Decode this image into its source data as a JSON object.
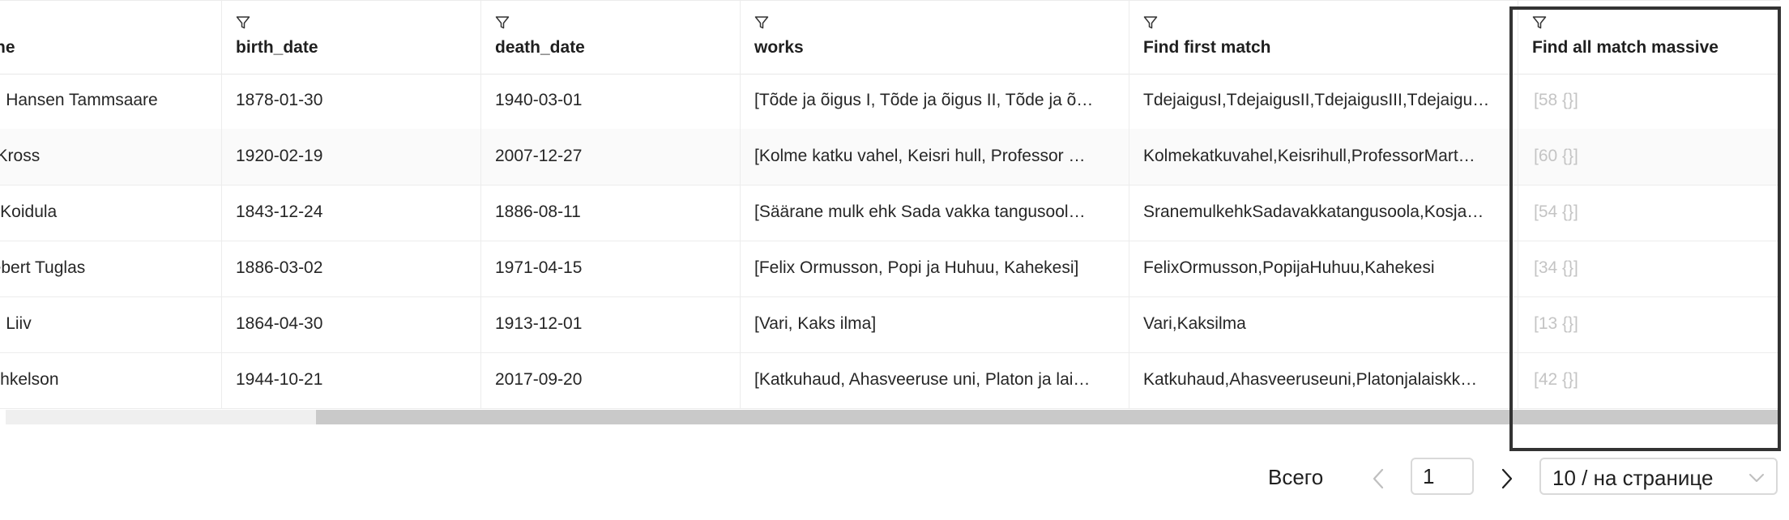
{
  "table": {
    "columns": [
      {
        "label": "ne"
      },
      {
        "label": "birth_date"
      },
      {
        "label": "death_date"
      },
      {
        "label": "works"
      },
      {
        "label": "Find first match"
      },
      {
        "label": "Find all match massive"
      }
    ],
    "rows": [
      {
        "cells": [
          "on Hansen Tammsaare",
          "1878-01-30",
          "1940-03-01",
          "[Tõde ja õigus I, Tõde ja õigus II, Tõde ja õ…",
          "TdejaigusI,TdejaigusII,TdejaigusIII,Tdejaigu…",
          "[58 {}]"
        ]
      },
      {
        "cells": [
          "n Kross",
          "1920-02-19",
          "2007-12-27",
          "[Kolme katku vahel, Keisri hull, Professor …",
          "Kolmekatkuvahel,Keisrihull,ProfessorMart…",
          "[60 {}]"
        ]
      },
      {
        "cells": [
          "ia Koidula",
          "1843-12-24",
          "1886-08-11",
          "[Säärane mulk ehk Sada vakka tangusool…",
          "SranemulkehkSadavakkatangusoola,Kosja…",
          "[54 {}]"
        ]
      },
      {
        "cells": [
          "debert Tuglas",
          "1886-03-02",
          "1971-04-15",
          "[Felix Ormusson, Popi ja Huhuu, Kahekesi]",
          "FelixOrmusson,PopijaHuhuu,Kahekesi",
          "[34 {}]"
        ]
      },
      {
        "cells": [
          "an Liiv",
          "1864-04-30",
          "1913-12-01",
          "[Vari, Kaks ilma]",
          "Vari,Kaksilma",
          "[13 {}]"
        ]
      },
      {
        "cells": [
          " Mihkelson",
          "1944-10-21",
          "2017-09-20",
          "[Katkuhaud, Ahasveeruse uni, Platon ja lai…",
          "Katkuhaud,Ahasveeruseuni,Platonjalaiskk…",
          "[42 {}]"
        ]
      }
    ]
  },
  "icons": {
    "filter": "filter-funnel-icon",
    "prev": "chevron-left-icon",
    "next": "chevron-right-icon",
    "dropdown": "chevron-down-icon"
  },
  "pagination": {
    "total_label": "Всего",
    "current_page": "1",
    "page_size_label": "10 / на странице"
  },
  "colors": {
    "highlight_border": "#333333",
    "muted_text": "#c4c4c4",
    "scroll_thumb": "#c9c9c9"
  }
}
